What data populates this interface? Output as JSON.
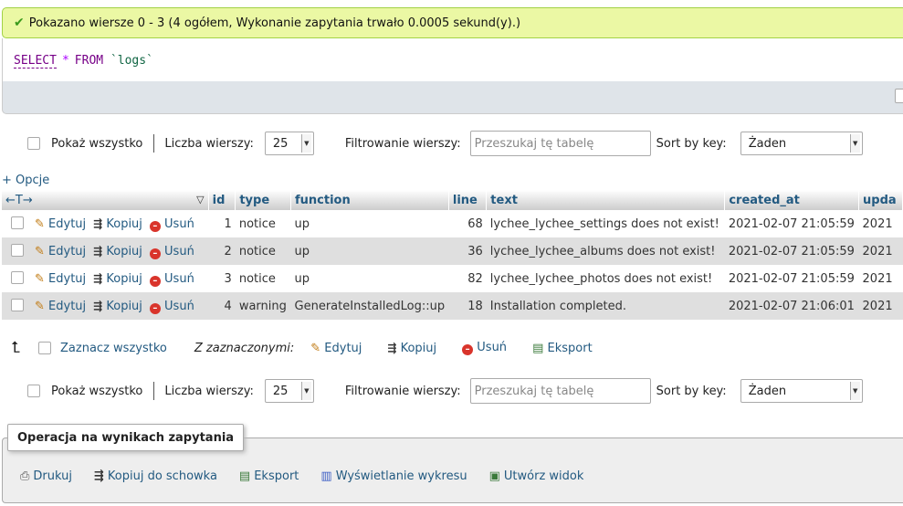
{
  "message": {
    "text": "Pokazano wiersze 0 - 3 (4 ogółem, Wykonanie zapytania trwało 0.0005 sekund(y).)"
  },
  "sql": {
    "select": "SELECT",
    "star": "*",
    "from": "FROM",
    "table": "`logs`"
  },
  "nav": {
    "show_all": "Pokaż wszystko",
    "rows_label": "Liczba wierszy:",
    "rows_value": "25",
    "filter_label": "Filtrowanie wierszy:",
    "filter_placeholder": "Przeszukaj tę tabelę",
    "sort_label": "Sort by key:",
    "sort_value": "Żaden"
  },
  "options_link": "+ Opcje",
  "table": {
    "arrows": "←T→",
    "columns": [
      "id",
      "type",
      "function",
      "line",
      "text",
      "created_at",
      "upda"
    ],
    "actions": {
      "edit": "Edytuj",
      "copy": "Kopiuj",
      "delete": "Usuń"
    },
    "rows": [
      {
        "id": "1",
        "type": "notice",
        "function": "up",
        "line": "68",
        "text": "lychee_lychee_settings does not exist!",
        "created_at": "2021-02-07 21:05:59",
        "updated_at": "2021"
      },
      {
        "id": "2",
        "type": "notice",
        "function": "up",
        "line": "36",
        "text": "lychee_lychee_albums does not exist!",
        "created_at": "2021-02-07 21:05:59",
        "updated_at": "2021"
      },
      {
        "id": "3",
        "type": "notice",
        "function": "up",
        "line": "82",
        "text": "lychee_lychee_photos does not exist!",
        "created_at": "2021-02-07 21:05:59",
        "updated_at": "2021"
      },
      {
        "id": "4",
        "type": "warning",
        "function": "GenerateInstalledLog::up",
        "line": "18",
        "text": "Installation completed.",
        "created_at": "2021-02-07 21:06:01",
        "updated_at": "2021"
      }
    ]
  },
  "bulk": {
    "check_all": "Zaznacz wszystko",
    "with_selected": "Z zaznaczonymi:",
    "edit": "Edytuj",
    "copy": "Kopiuj",
    "delete": "Usuń",
    "export": "Eksport"
  },
  "query_ops": {
    "legend": "Operacja na wynikach zapytania",
    "print": "Drukuj",
    "copy_clipboard": "Kopiuj do schowka",
    "export": "Eksport",
    "chart": "Wyświetlanie wykresu",
    "create_view": "Utwórz widok"
  },
  "colors": {
    "success_bg": "#ebf8a4",
    "link": "#235a81",
    "row_even": "#dfdfdf"
  }
}
